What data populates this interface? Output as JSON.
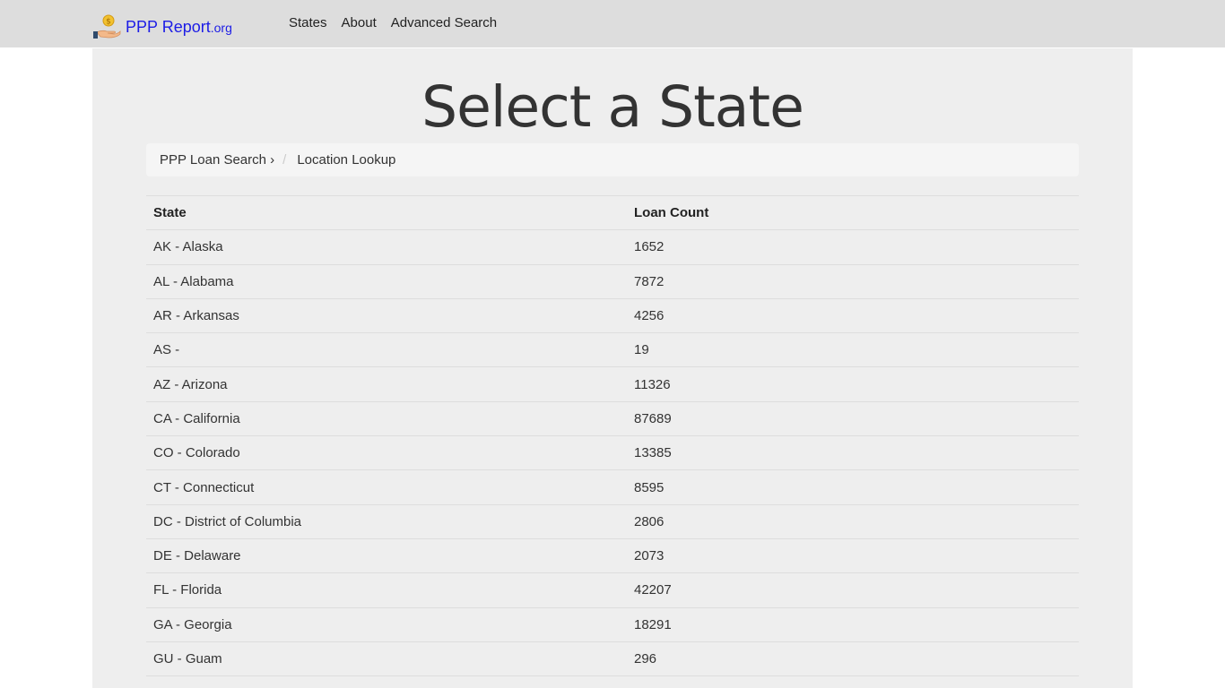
{
  "header": {
    "brand_name": "PPP Report",
    "brand_suffix": ".org",
    "nav": [
      {
        "label": "States"
      },
      {
        "label": "About"
      },
      {
        "label": "Advanced Search"
      }
    ]
  },
  "main": {
    "title": "Select a State",
    "breadcrumb": [
      {
        "label": "PPP Loan Search ›"
      },
      {
        "label": "Location Lookup"
      }
    ],
    "breadcrumb_separator": "/",
    "table": {
      "headers": [
        "State",
        "Loan Count"
      ],
      "rows": [
        [
          "AK - Alaska",
          "1652"
        ],
        [
          "AL - Alabama",
          "7872"
        ],
        [
          "AR - Arkansas",
          "4256"
        ],
        [
          "AS - ",
          "19"
        ],
        [
          "AZ - Arizona",
          "11326"
        ],
        [
          "CA - California",
          "87689"
        ],
        [
          "CO - Colorado",
          "13385"
        ],
        [
          "CT - Connecticut",
          "8595"
        ],
        [
          "DC - District of Columbia",
          "2806"
        ],
        [
          "DE - Delaware",
          "2073"
        ],
        [
          "FL - Florida",
          "42207"
        ],
        [
          "GA - Georgia",
          "18291"
        ],
        [
          "GU - Guam",
          "296"
        ]
      ]
    }
  },
  "colors": {
    "navbar_bg": "#dddddd",
    "container_bg": "#eeeeee",
    "brand": "#1c1ce6",
    "breadcrumb_bg": "#f5f5f5"
  },
  "icons": {
    "brand_logo": "money-hand-icon"
  }
}
